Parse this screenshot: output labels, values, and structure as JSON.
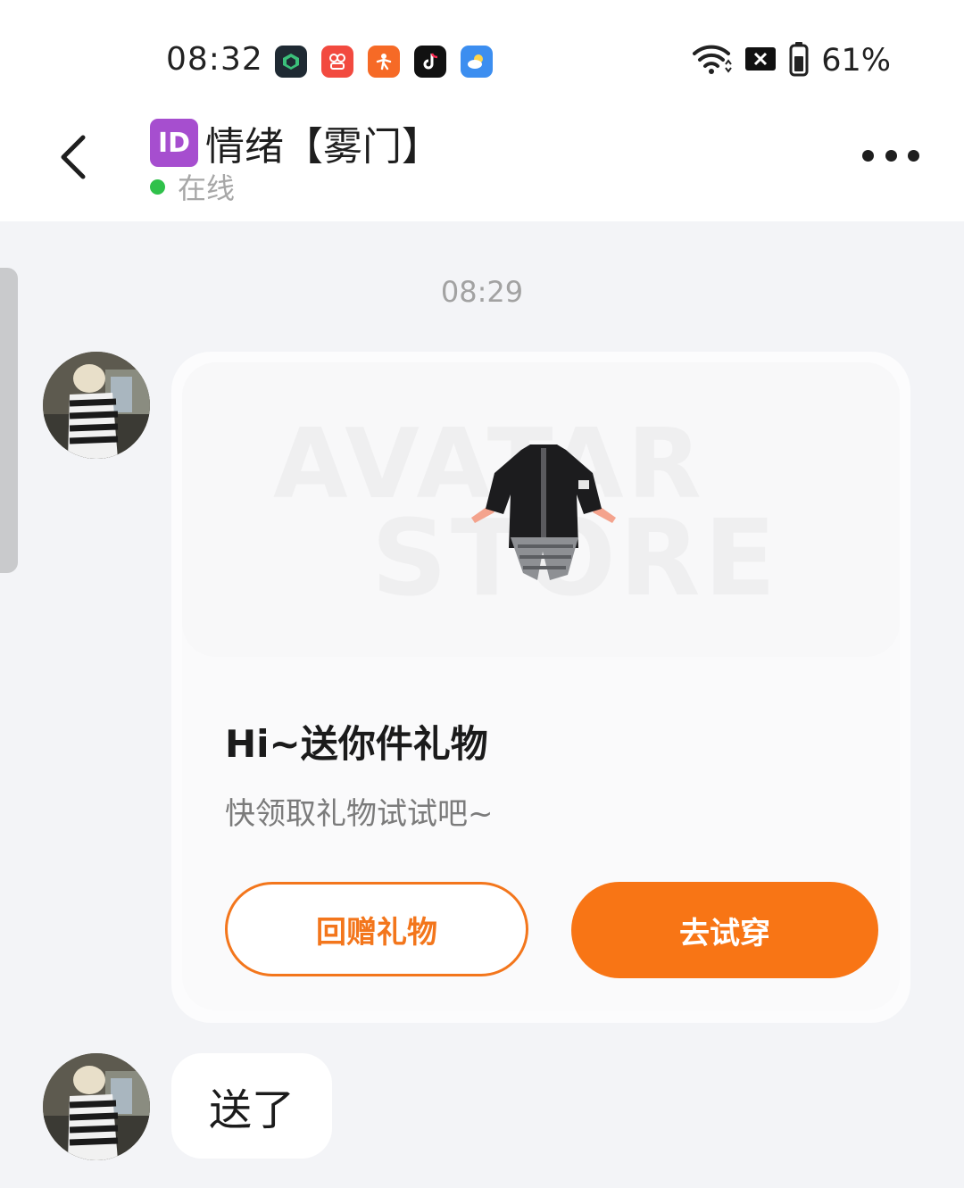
{
  "status_bar": {
    "time": "08:32",
    "battery": "61%",
    "app_icons": [
      {
        "name": "cube-app-icon",
        "color": "#1f2a33"
      },
      {
        "name": "live-app-icon",
        "color": "#f24a3f"
      },
      {
        "name": "runner-app-icon",
        "color": "#f66a26"
      },
      {
        "name": "tiktok-icon",
        "color": "#111111"
      },
      {
        "name": "weather-icon",
        "color": "#3c8ef0"
      }
    ]
  },
  "header": {
    "badge": "ID",
    "title": "情绪【雾门】",
    "status": "在线"
  },
  "chat": {
    "timestamp": "08:29",
    "gift_card": {
      "watermark_line1": "AVATAR",
      "watermark_line2": "STORE",
      "title": "Hi~送你件礼物",
      "subtitle": "快领取礼物试试吧~",
      "return_gift_label": "回赠礼物",
      "try_on_label": "去试穿"
    },
    "text_message": "送了"
  },
  "colors": {
    "accent": "#f87515",
    "online": "#2fc14a",
    "id_badge": "#a64ecf"
  }
}
